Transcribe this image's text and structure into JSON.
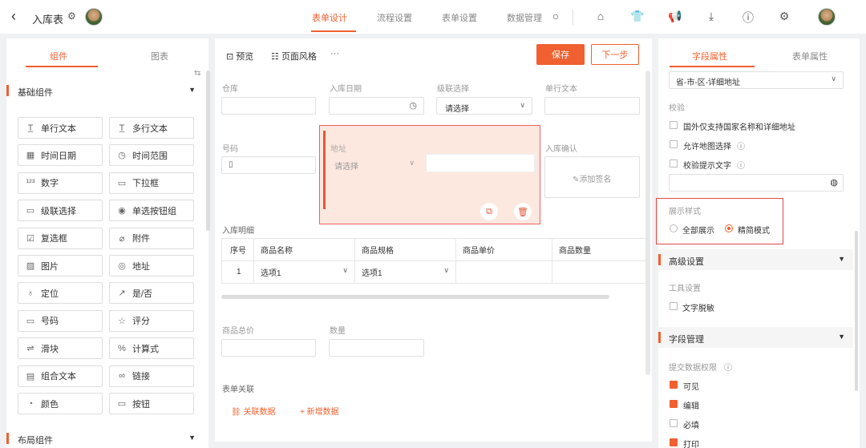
{
  "header": {
    "back_icon": "‹",
    "title": "入库表",
    "tabs": [
      {
        "label": "表单设计"
      },
      {
        "label": "流程设置"
      },
      {
        "label": "表单设置"
      },
      {
        "label": "数据管理"
      }
    ]
  },
  "left": {
    "tabs": [
      "组件",
      "图表"
    ],
    "group_basic": "基础组件",
    "group_layout": "布局组件",
    "components": [
      [
        "单行文本",
        "多行文本"
      ],
      [
        "时间日期",
        "时间范围"
      ],
      [
        "数字",
        "下拉框"
      ],
      [
        "级联选择",
        "单选按钮组"
      ],
      [
        "复选框",
        "附件"
      ],
      [
        "图片",
        "地址"
      ],
      [
        "定位",
        "是/否"
      ],
      [
        "号码",
        "评分"
      ],
      [
        "滑块",
        "计算式"
      ],
      [
        "组合文本",
        "链接"
      ],
      [
        "颜色",
        "按钮"
      ]
    ],
    "component_icons": [
      [
        "T̲",
        "T̲"
      ],
      [
        "▦",
        "◷"
      ],
      [
        "¹²³",
        "▭"
      ],
      [
        "▭",
        "◉"
      ],
      [
        "☑",
        "⌀"
      ],
      [
        "▨",
        "◎"
      ],
      [
        "♁",
        "↗"
      ],
      [
        "▭",
        "☆"
      ],
      [
        "⇌",
        "%"
      ],
      [
        "▤",
        "∞"
      ],
      [
        "◔",
        "▭"
      ]
    ]
  },
  "toolbar": {
    "preview": "预览",
    "style": "页面风格",
    "more": "···",
    "save": "保存",
    "next": "下一步"
  },
  "form": {
    "warehouse": "仓库",
    "in_date": "入库日期",
    "cascade": "级联选择",
    "cascade_placeholder": "请选择",
    "single_text": "单行文本",
    "number_field": "号码",
    "address": "地址",
    "address_placeholder": "请选择",
    "confirm": "入库确认",
    "sign": "✎添加签名",
    "detail_title": "入库明细",
    "table_headers": [
      "序号",
      "商品名称",
      "商品规格",
      "商品单价",
      "商品数量"
    ],
    "table_row": [
      "1",
      "选项1",
      "选项1",
      "",
      ""
    ],
    "total_price": "商品总价",
    "quantity": "数量",
    "relation_title": "表单关联",
    "link_data": "关联数据",
    "add_data": "新增数据"
  },
  "right": {
    "tabs": [
      "字段属性",
      "表单属性"
    ],
    "address_format": "省-市-区-详细地址",
    "validate_title": "校验",
    "validate_opts": [
      "国外仅支持国家名称和详细地址",
      "允许地图选择",
      "校验提示文字"
    ],
    "display_title": "展示样式",
    "display_opts": [
      "全部展示",
      "精简模式"
    ],
    "advanced": "高级设置",
    "tool_title": "工具设置",
    "tool_opt": "文字脱敏",
    "field_mgmt": "字段管理",
    "perm_title": "提交数据权限",
    "perms": [
      "可见",
      "编辑",
      "必填",
      "打印"
    ]
  }
}
